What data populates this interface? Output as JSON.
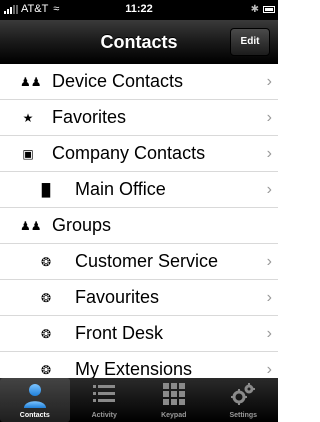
{
  "status_bar": {
    "carrier": "AT&T",
    "time": "11:22"
  },
  "nav": {
    "title": "Contacts",
    "edit_label": "Edit"
  },
  "list": {
    "items": [
      {
        "label": "Device Contacts",
        "icon": "people-icon",
        "level": 0,
        "chevron": true
      },
      {
        "label": "Favorites",
        "icon": "star-icon",
        "level": 0,
        "chevron": true
      },
      {
        "label": "Company Contacts",
        "icon": "company-icon",
        "level": 0,
        "chevron": true
      },
      {
        "label": "Main Office",
        "icon": "office-icon",
        "level": 1,
        "chevron": true
      },
      {
        "label": "Groups",
        "icon": "people-icon",
        "level": 0,
        "chevron": false
      },
      {
        "label": "Customer Service",
        "icon": "group-icon",
        "level": 1,
        "chevron": true
      },
      {
        "label": "Favourites",
        "icon": "group-icon",
        "level": 1,
        "chevron": true
      },
      {
        "label": "Front Desk",
        "icon": "group-icon",
        "level": 1,
        "chevron": true
      },
      {
        "label": "My Extensions",
        "icon": "group-icon",
        "level": 1,
        "chevron": true
      }
    ],
    "chevron": "›"
  },
  "tabs": [
    {
      "label": "Contacts",
      "icon": "person-icon",
      "active": true
    },
    {
      "label": "Activity",
      "icon": "list-icon",
      "active": false
    },
    {
      "label": "Keypad",
      "icon": "keypad-icon",
      "active": false
    },
    {
      "label": "Settings",
      "icon": "gears-icon",
      "active": false
    }
  ],
  "colors": {
    "active_tab": "#2f8fe6",
    "chevron": "#9a9a9a"
  }
}
